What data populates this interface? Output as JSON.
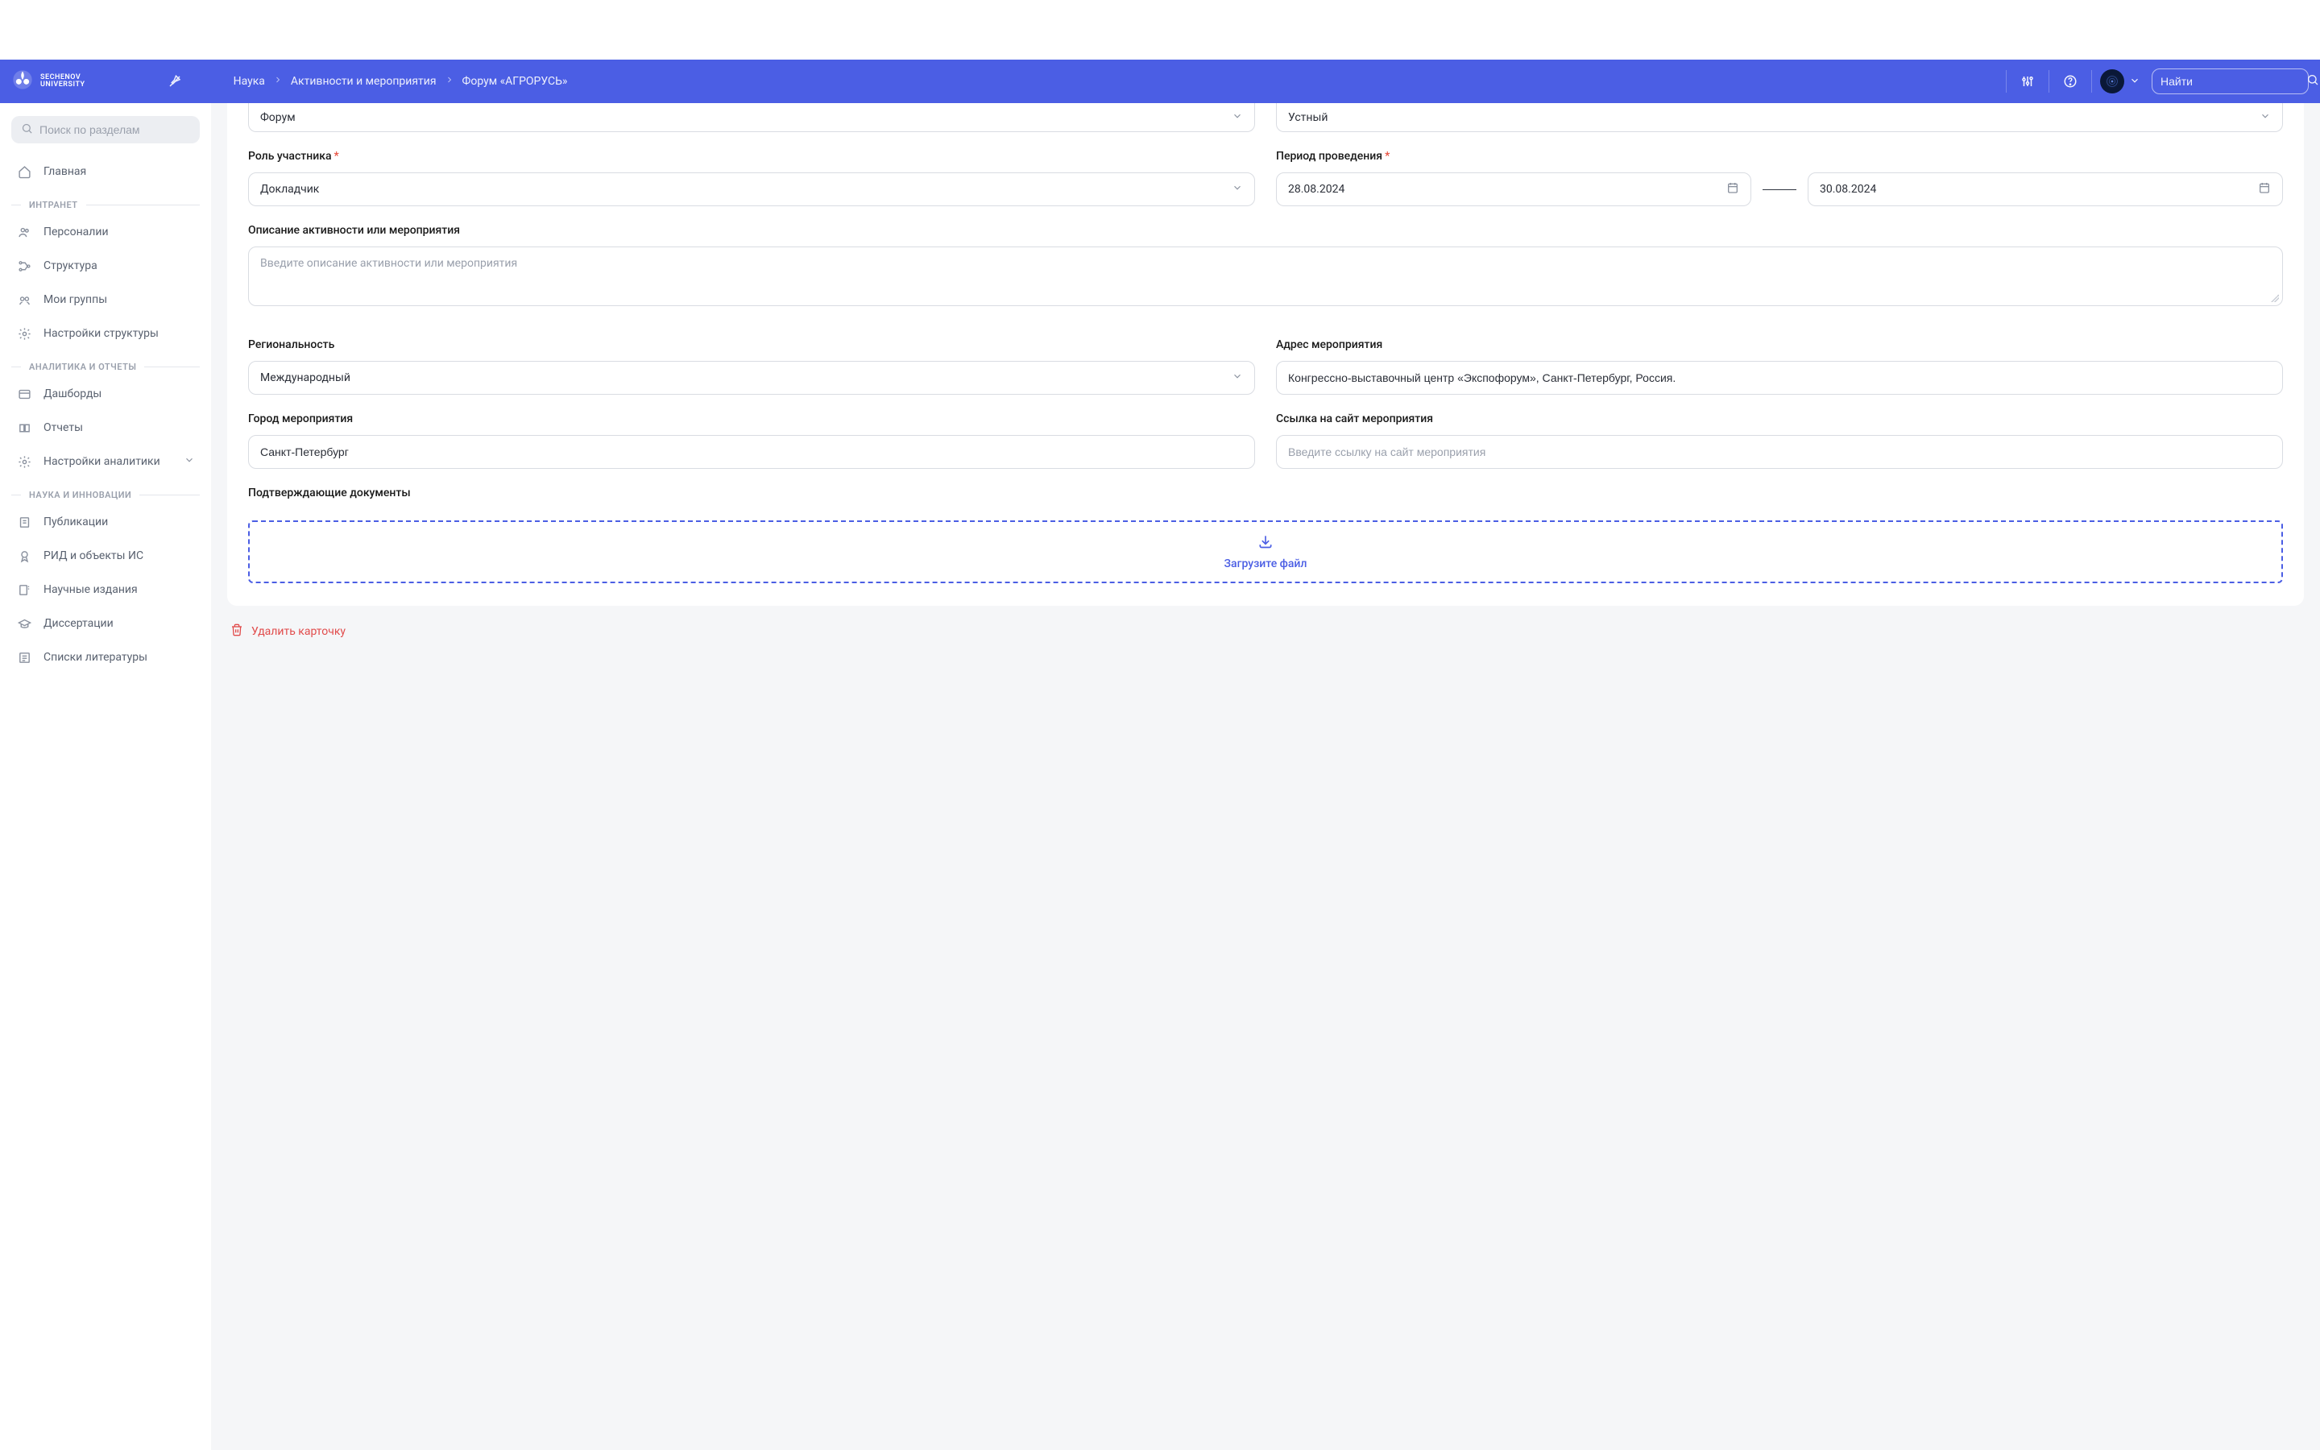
{
  "header": {
    "logo_line1": "SECHENOV",
    "logo_line2": "UNIVERSITY",
    "search_placeholder": "Найти"
  },
  "breadcrumbs": {
    "items": [
      "Наука",
      "Активности и мероприятия",
      "Форум «АГРОРУСЬ»"
    ]
  },
  "sidebar": {
    "search_placeholder": "Поиск по разделам",
    "main_label": "Главная",
    "sections": {
      "intranet": {
        "title": "ИНТРАНЕТ",
        "items": [
          "Персоналии",
          "Структура",
          "Мои группы",
          "Настройки структуры"
        ]
      },
      "analytics": {
        "title": "АНАЛИТИКА И ОТЧЕТЫ",
        "items": [
          "Дашборды",
          "Отчеты",
          "Настройки аналитики"
        ]
      },
      "science": {
        "title": "НАУКА И ИННОВАЦИИ",
        "items": [
          "Публикации",
          "РИД и объекты ИС",
          "Научные издания",
          "Диссертации",
          "Списки литературы"
        ]
      }
    }
  },
  "form": {
    "top": {
      "type_value": "Форум",
      "format_value": "Устный"
    },
    "role": {
      "label": "Роль участника",
      "value": "Докладчик"
    },
    "period": {
      "label": "Период проведения",
      "start": "28.08.2024",
      "end": "30.08.2024"
    },
    "description": {
      "label": "Описание активности или мероприятия",
      "placeholder": "Введите описание активности или мероприятия"
    },
    "regionality": {
      "label": "Региональность",
      "value": "Международный"
    },
    "address": {
      "label": "Адрес мероприятия",
      "value": "Конгрессно-выставочный центр «Экспофорум», Санкт-Петербург, Россия."
    },
    "city": {
      "label": "Город мероприятия",
      "value": "Санкт-Петербург"
    },
    "website": {
      "label": "Ссылка на сайт мероприятия",
      "placeholder": "Введите ссылку на сайт мероприятия"
    },
    "documents": {
      "label": "Подтверждающие документы",
      "upload_text": "Загрузите файл"
    }
  },
  "actions": {
    "delete_card": "Удалить карточку"
  }
}
